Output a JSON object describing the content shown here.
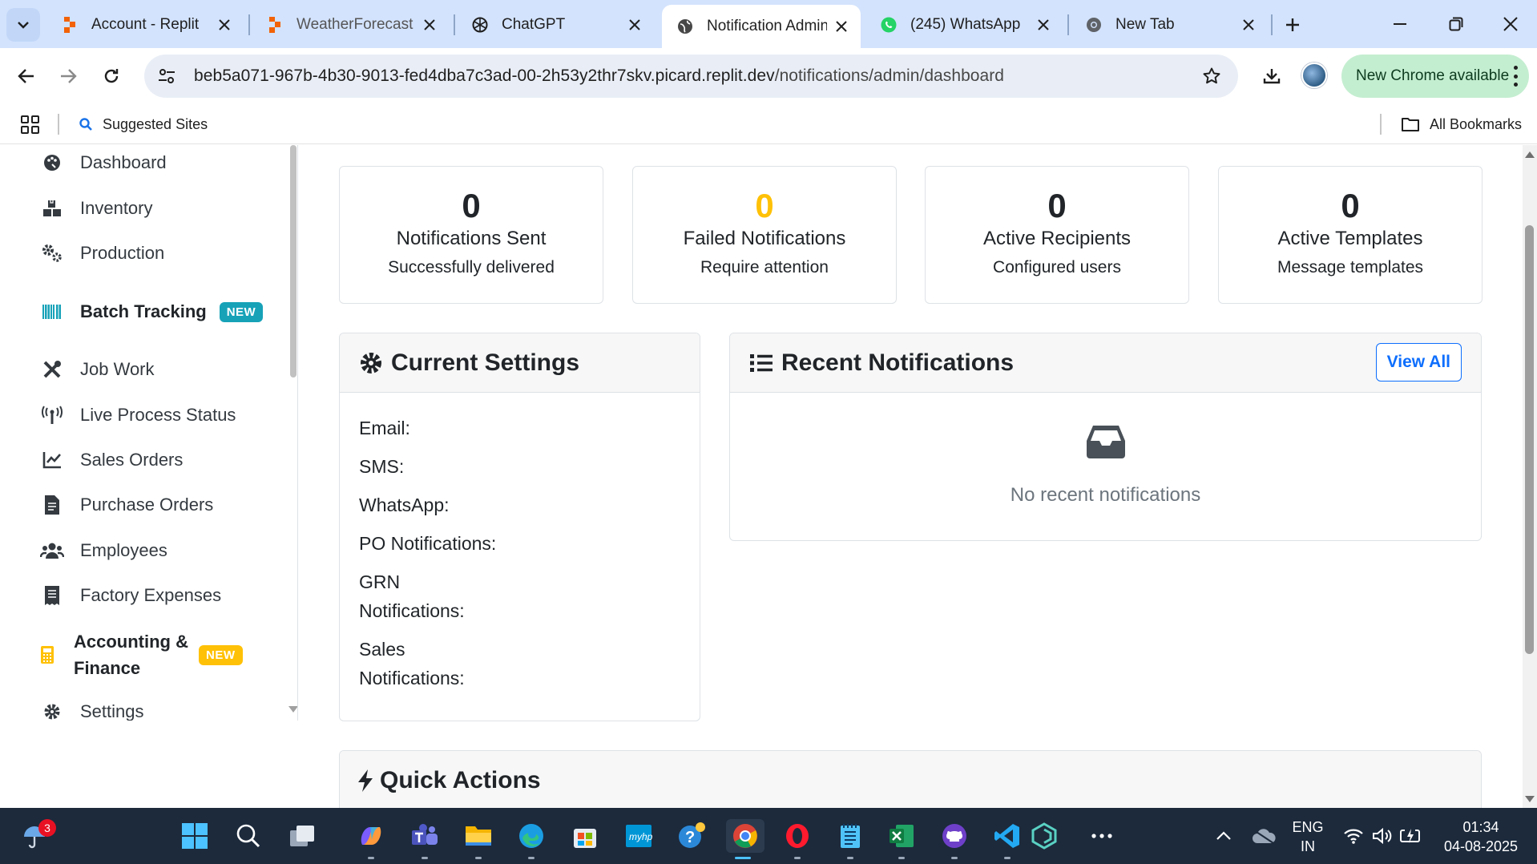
{
  "browser": {
    "tabs": [
      {
        "title": "Account - Replit",
        "favicon": "replit-icon",
        "active": false
      },
      {
        "title": "WeatherForecast -",
        "favicon": "replit-icon",
        "active": false
      },
      {
        "title": "ChatGPT",
        "favicon": "chatgpt-icon",
        "active": false
      },
      {
        "title": "Notification Admin",
        "favicon": "globe-icon",
        "active": true
      },
      {
        "title": "(245) WhatsApp",
        "favicon": "whatsapp-icon",
        "active": false
      },
      {
        "title": "New Tab",
        "favicon": "chrome-icon",
        "active": false
      }
    ],
    "url_host": "beb5a071-967b-4b30-9013-fed4dba7c3ad-00-2h53y2thr7skv.picard.replit.dev",
    "url_path": "/notifications/admin/dashboard",
    "update_label": "New Chrome available",
    "bookmarks": {
      "suggested": "Suggested Sites",
      "all": "All Bookmarks"
    }
  },
  "sidebar": {
    "items": [
      {
        "label": "Dashboard",
        "icon": "palette-icon"
      },
      {
        "label": "Inventory",
        "icon": "boxes-icon"
      },
      {
        "label": "Production",
        "icon": "cogs-icon"
      },
      {
        "label": "Batch Tracking",
        "icon": "barcode-icon",
        "badge": "NEW"
      },
      {
        "label": "Job Work",
        "icon": "tools-icon"
      },
      {
        "label": "Live Process Status",
        "icon": "broadcast-icon"
      },
      {
        "label": "Sales Orders",
        "icon": "chart-line-icon"
      },
      {
        "label": "Purchase Orders",
        "icon": "file-icon"
      },
      {
        "label": "Employees",
        "icon": "users-icon"
      },
      {
        "label": "Factory Expenses",
        "icon": "receipt-icon"
      },
      {
        "label": "Accounting & Finance",
        "icon": "calculator-icon",
        "badge": "NEW"
      },
      {
        "label": "Settings",
        "icon": "gear-icon"
      }
    ]
  },
  "stats": [
    {
      "value": "0",
      "label": "Notifications Sent",
      "sub": "Successfully delivered"
    },
    {
      "value": "0",
      "label": "Failed Notifications",
      "sub": "Require attention",
      "color": "#ffc107"
    },
    {
      "value": "0",
      "label": "Active Recipients",
      "sub": "Configured users"
    },
    {
      "value": "0",
      "label": "Active Templates",
      "sub": "Message templates"
    }
  ],
  "settings_panel": {
    "title": "Current Settings",
    "rows": [
      "Email:",
      "SMS:",
      "WhatsApp:",
      "PO Notifications:",
      "GRN Notifications:",
      "Sales Notifications:"
    ]
  },
  "recent_panel": {
    "title": "Recent Notifications",
    "view_all": "View All",
    "empty_text": "No recent notifications"
  },
  "quick_actions": {
    "title": "Quick Actions"
  },
  "taskbar": {
    "notification_count": "3",
    "language": "ENG",
    "region": "IN",
    "time": "01:34",
    "date": "04-08-2025"
  },
  "colors": {
    "tabstrip": "#d3e3fd",
    "badge_info": "#17a2b8",
    "badge_warning": "#ffc107",
    "primary": "#0d6efd",
    "taskbar": "#1c2a3c"
  }
}
